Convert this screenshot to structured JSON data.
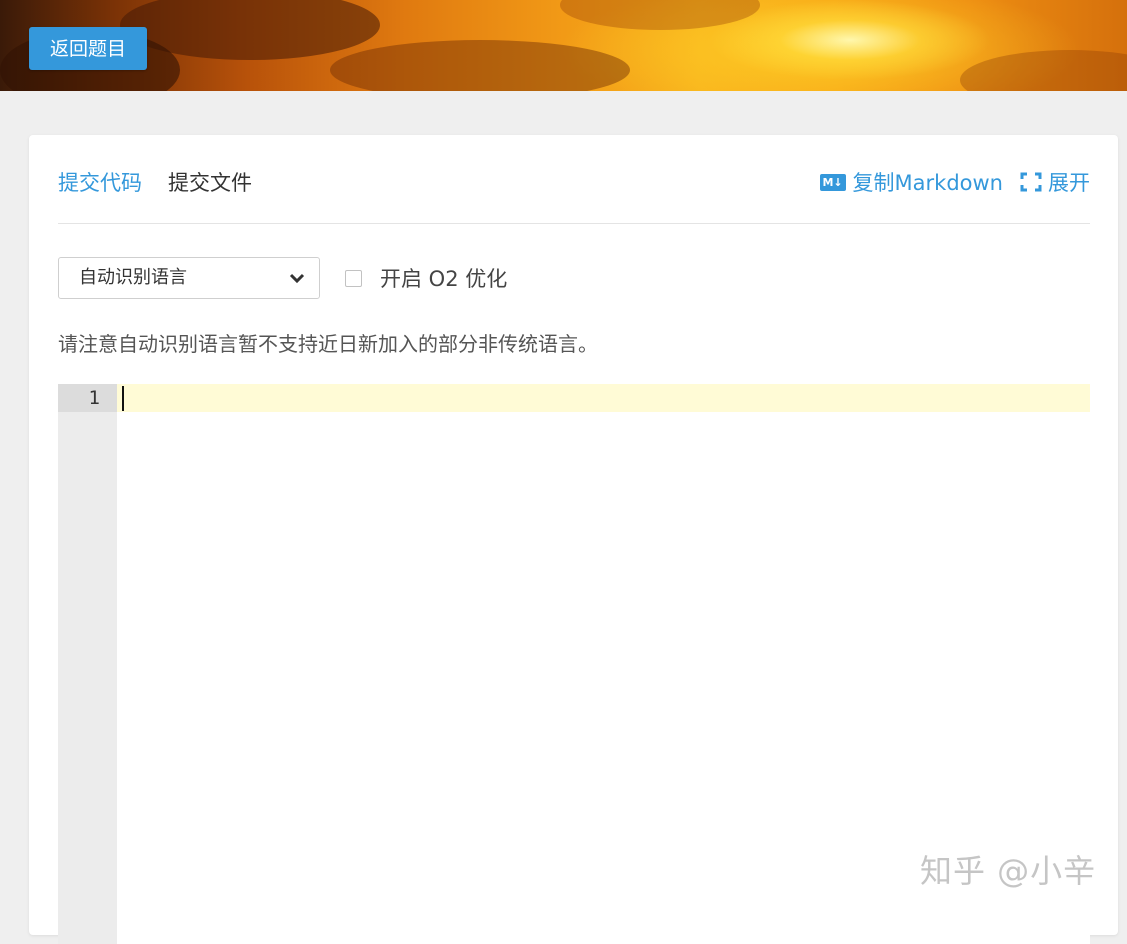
{
  "header": {
    "back_button_label": "返回题目"
  },
  "tabs": {
    "submit_code_label": "提交代码",
    "submit_file_label": "提交文件"
  },
  "tools": {
    "md_badge": "M↓",
    "copy_markdown_label": "复制Markdown",
    "expand_label": "展开"
  },
  "language_select": {
    "selected_value": "自动识别语言"
  },
  "o2_option": {
    "label": "开启 O2 优化",
    "checked": false
  },
  "notice": "请注意自动识别语言暂不支持近日新加入的部分非传统语言。",
  "editor": {
    "line_numbers": [
      "1"
    ],
    "content": ""
  },
  "watermark": "知乎 @小辛",
  "colors": {
    "accent": "#3498db",
    "active_line": "#fffbd6",
    "gutter": "#ececec"
  },
  "icons": {
    "markdown": "markdown-icon",
    "expand": "expand-icon",
    "dropdown": "chevron-down-icon"
  }
}
